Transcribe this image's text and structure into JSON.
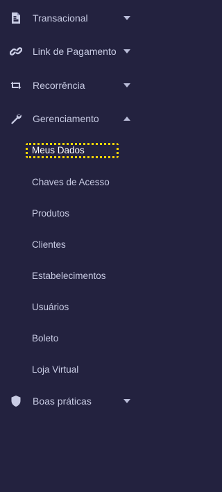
{
  "sidebar": {
    "sections": [
      {
        "label": "Transacional",
        "icon": "file-invoice-icon",
        "expanded": false
      },
      {
        "label": "Link de Pagamento",
        "icon": "link-icon",
        "expanded": false
      },
      {
        "label": "Recorrência",
        "icon": "retweet-icon",
        "expanded": false
      },
      {
        "label": "Gerenciamento",
        "icon": "wrench-icon",
        "expanded": true
      },
      {
        "label": "Boas práticas",
        "icon": "shield-icon",
        "expanded": false
      }
    ],
    "gerenciamento_items": [
      "Meus Dados",
      "Chaves de Acesso",
      "Produtos",
      "Clientes",
      "Estabelecimentos",
      "Usuários",
      "Boleto",
      "Loja Virtual"
    ],
    "active_item": "Meus Dados",
    "colors": {
      "background": "#23223f",
      "text": "#c9cce4",
      "highlight": "#ffd500"
    }
  }
}
